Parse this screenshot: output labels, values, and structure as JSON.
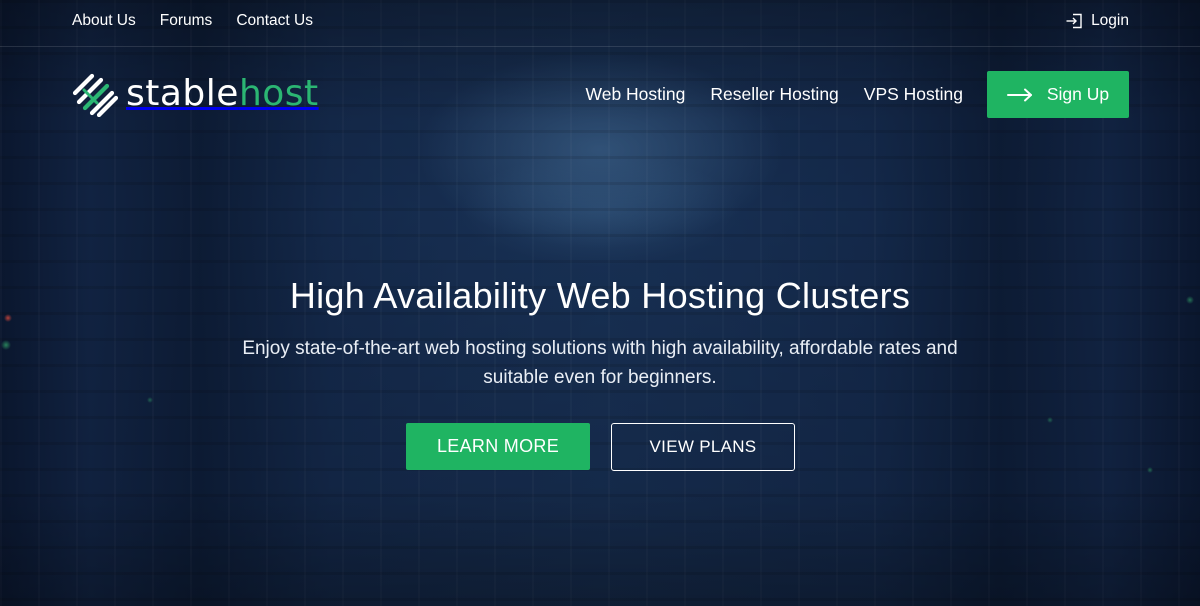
{
  "topbar": {
    "links": [
      "About Us",
      "Forums",
      "Contact Us"
    ],
    "login_label": "Login",
    "login_icon": "login-icon"
  },
  "brand": {
    "name_part1": "stable",
    "name_part2": "host",
    "logo_icon": "stablehost-logo-icon",
    "accent_color": "#2bb673"
  },
  "nav": {
    "items": [
      "Web Hosting",
      "Reseller Hosting",
      "VPS Hosting"
    ],
    "signup_label": "Sign Up",
    "signup_icon": "arrow-right-icon"
  },
  "hero": {
    "title": "High Availability Web Hosting Clusters",
    "subtitle": "Enjoy state-of-the-art web hosting solutions with high availability, affordable rates and suitable even for beginners.",
    "primary_button": "LEARN MORE",
    "secondary_button": "VIEW PLANS"
  },
  "colors": {
    "primary_green": "#1fb462",
    "background": "#0c1a33"
  }
}
